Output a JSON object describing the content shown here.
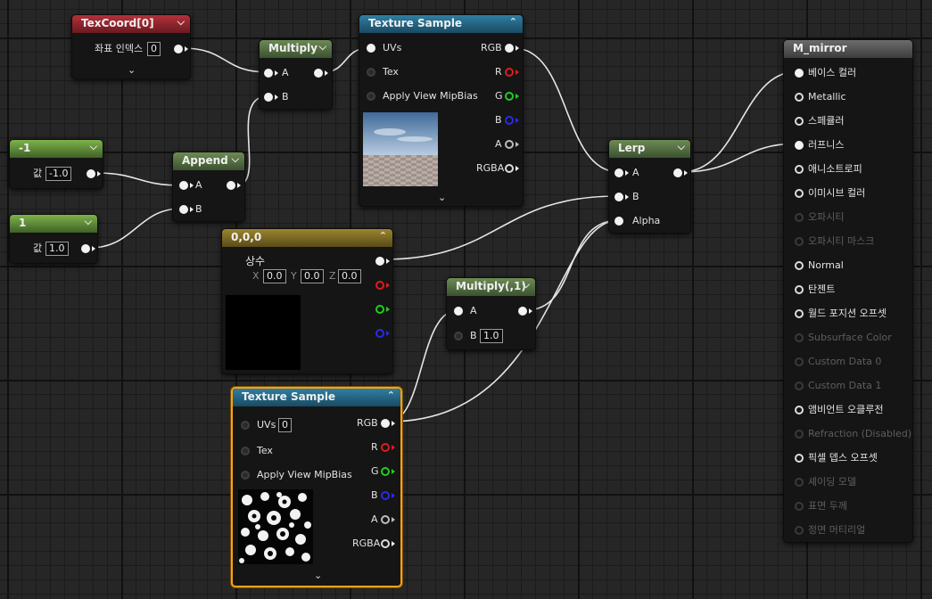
{
  "nodes": {
    "texcoord": {
      "title": "TexCoord[0]",
      "index_label": "좌표 인덱스",
      "index_value": "0"
    },
    "multiply1": {
      "title": "Multiply",
      "a": "A",
      "b": "B"
    },
    "texsample1": {
      "title": "Texture Sample",
      "uvs": "UVs",
      "tex": "Tex",
      "mip": "Apply View MipBias",
      "rgb": "RGB",
      "r": "R",
      "g": "G",
      "b": "B",
      "a": "A",
      "rgba": "RGBA"
    },
    "const_neg1": {
      "title": "-1",
      "value_label": "값",
      "value": "-1.0"
    },
    "const_1": {
      "title": "1",
      "value_label": "값",
      "value": "1.0"
    },
    "append": {
      "title": "Append",
      "a": "A",
      "b": "B"
    },
    "lerp": {
      "title": "Lerp",
      "a": "A",
      "b": "B",
      "alpha": "Alpha"
    },
    "constant3": {
      "title": "0,0,0",
      "label": "상수",
      "x_label": "X",
      "x": "0.0",
      "y_label": "Y",
      "y": "0.0",
      "z_label": "Z",
      "z": "0.0",
      "swatch": "#000000"
    },
    "multiply2": {
      "title": "Multiply(,1)",
      "a": "A",
      "b": "B",
      "b_value": "1.0"
    },
    "texsample2": {
      "title": "Texture Sample",
      "uvs": "UVs",
      "uvs_value": "0",
      "tex": "Tex",
      "mip": "Apply View MipBias",
      "rgb": "RGB",
      "r": "R",
      "g": "G",
      "b": "B",
      "a": "A",
      "rgba": "RGBA"
    },
    "material": {
      "title": "M_mirror",
      "inputs": [
        {
          "label": "베이스 컬러",
          "state": "connected"
        },
        {
          "label": "Metallic",
          "state": "open"
        },
        {
          "label": "스페큘러",
          "state": "open"
        },
        {
          "label": "러프니스",
          "state": "connected"
        },
        {
          "label": "애니소트로피",
          "state": "open"
        },
        {
          "label": "이미시브 컬러",
          "state": "open"
        },
        {
          "label": "오파시티",
          "state": "disabled"
        },
        {
          "label": "오파시티 마스크",
          "state": "disabled"
        },
        {
          "label": "Normal",
          "state": "open"
        },
        {
          "label": "탄젠트",
          "state": "open"
        },
        {
          "label": "월드 포지션 오프셋",
          "state": "open"
        },
        {
          "label": "Subsurface Color",
          "state": "disabled"
        },
        {
          "label": "Custom Data 0",
          "state": "disabled"
        },
        {
          "label": "Custom Data 1",
          "state": "disabled"
        },
        {
          "label": "앰비언트 오클루전",
          "state": "open"
        },
        {
          "label": "Refraction (Disabled)",
          "state": "disabled"
        },
        {
          "label": "픽셀 뎁스 오프셋",
          "state": "open"
        },
        {
          "label": "셰이딩 모델",
          "state": "disabled"
        },
        {
          "label": "표면 두께",
          "state": "disabled"
        },
        {
          "label": "정면 머티리얼",
          "state": "disabled"
        }
      ]
    }
  },
  "colors": {
    "texcoord_header": "#b4303a",
    "math_header": "#6d8a55",
    "constant_header": "#7fb24c",
    "texture_header": "#2f7fa3",
    "vector_header": "#9b8530",
    "material_header": "#6c6c6c",
    "selection": "#f3a21c",
    "wire": "#e6e6e6"
  }
}
